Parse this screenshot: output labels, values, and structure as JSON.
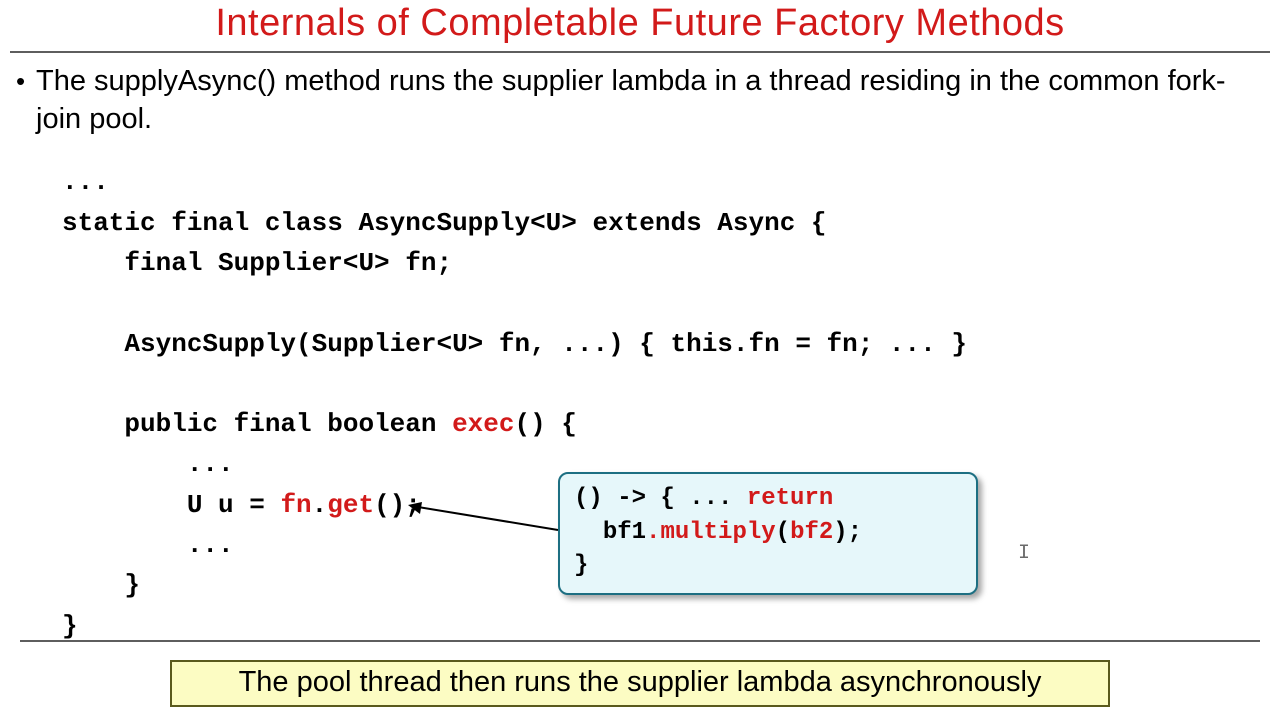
{
  "title": "Internals of Completable Future Factory Methods",
  "bullet": "The supplyAsync() method runs the supplier lambda in a thread residing in the common fork-join pool.",
  "code": {
    "l1": "...",
    "l2a": "static final class AsyncSupply<U> extends Async {",
    "l3": "    final Supplier<U> fn;",
    "l4": "",
    "l5": "    AsyncSupply(Supplier<U> fn, ...) { this.fn = fn; ... }",
    "l6": "",
    "l7a": "    public final boolean ",
    "l7b": "exec",
    "l7c": "() {",
    "l8": "        ...",
    "l9a": "        U u = ",
    "l9b": "fn",
    "l9c": ".",
    "l9d": "get",
    "l9e": "();",
    "l10": "        ...",
    "l11": "    }",
    "l12": "}"
  },
  "callout": {
    "c1": "() -> { ... ",
    "c2": "return",
    "c3": "\n  bf1",
    "c4": ".",
    "c5": "multiply",
    "c6": "(",
    "c7": "bf2",
    "c8": ");\n}"
  },
  "footer": "The pool thread then runs the supplier lambda asynchronously"
}
